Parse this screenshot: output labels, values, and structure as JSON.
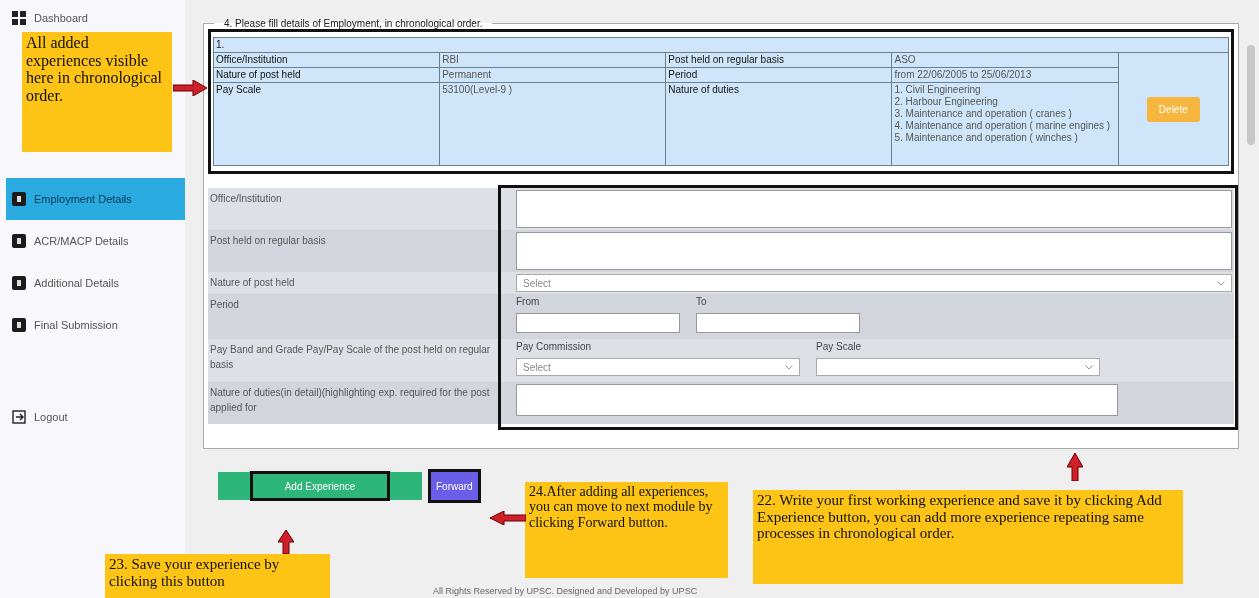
{
  "sidebar": {
    "items": [
      {
        "label": "Dashboard",
        "selected": false,
        "kind": "grid"
      },
      {
        "label": "Employment Details",
        "selected": true,
        "kind": "step"
      },
      {
        "label": "ACR/MACP Details",
        "selected": false,
        "kind": "step"
      },
      {
        "label": "Additional Details",
        "selected": false,
        "kind": "step"
      },
      {
        "label": "Final Submission",
        "selected": false,
        "kind": "step"
      }
    ],
    "logout": "Logout"
  },
  "section": {
    "legend": "4. Please fill details of Employment, in chronological order.",
    "record": {
      "number": "1.",
      "rows": [
        {
          "label": "Office/Institution",
          "value": "RBI",
          "label_2": "Post held on regular basis",
          "value_2": "ASO"
        },
        {
          "label": "Nature of post held",
          "value": "Permanent",
          "label_2": "Period",
          "value_2": "from 22/06/2005 to 25/06/2013"
        }
      ],
      "pay_label": "Pay Scale",
      "pay_value": "53100(Level-9 )",
      "duties_label": "Nature of duties",
      "duties": [
        "1. Civil Engineering",
        "2. Harbour Engineering",
        "3. Maintenance and operation ( cranes )",
        "4. Maintenance and operation ( marine engines )",
        "5. Maintenance and operation ( winches )"
      ],
      "delete_button": "Delete"
    },
    "form": [
      {
        "kind": "textarea",
        "label": "Office/Institution"
      },
      {
        "kind": "textarea",
        "label": "Post held on regular basis"
      },
      {
        "kind": "select",
        "label": "Nature of post held",
        "placeholder": "Select"
      },
      {
        "kind": "period",
        "label": "Period",
        "from": "From",
        "to": "To"
      },
      {
        "kind": "payscale",
        "label": "Pay Band and Grade Pay/Pay Scale of the post held on regular basis",
        "commission": "Pay Commission",
        "commission_placeholder": "Select",
        "scale": "Pay Scale"
      },
      {
        "kind": "text",
        "label": "Nature of duties(in detail)(highlighting exp. required for the post applied for"
      }
    ]
  },
  "buttons": {
    "add": "Add Experience",
    "forward": "Forward"
  },
  "footer": "All Rights Reserved by UPSC. Designed and Developed by UPSC",
  "annotations": [
    "All added experiences visible here in chronological order.",
    "23. Save your experience by clicking this button",
    "24.After adding all experiences, you can move to next module by clicking Forward button.",
    "22. Write your first working experience and save it by clicking Add Experience button, you can add more experience repeating same processes in chronological order."
  ]
}
